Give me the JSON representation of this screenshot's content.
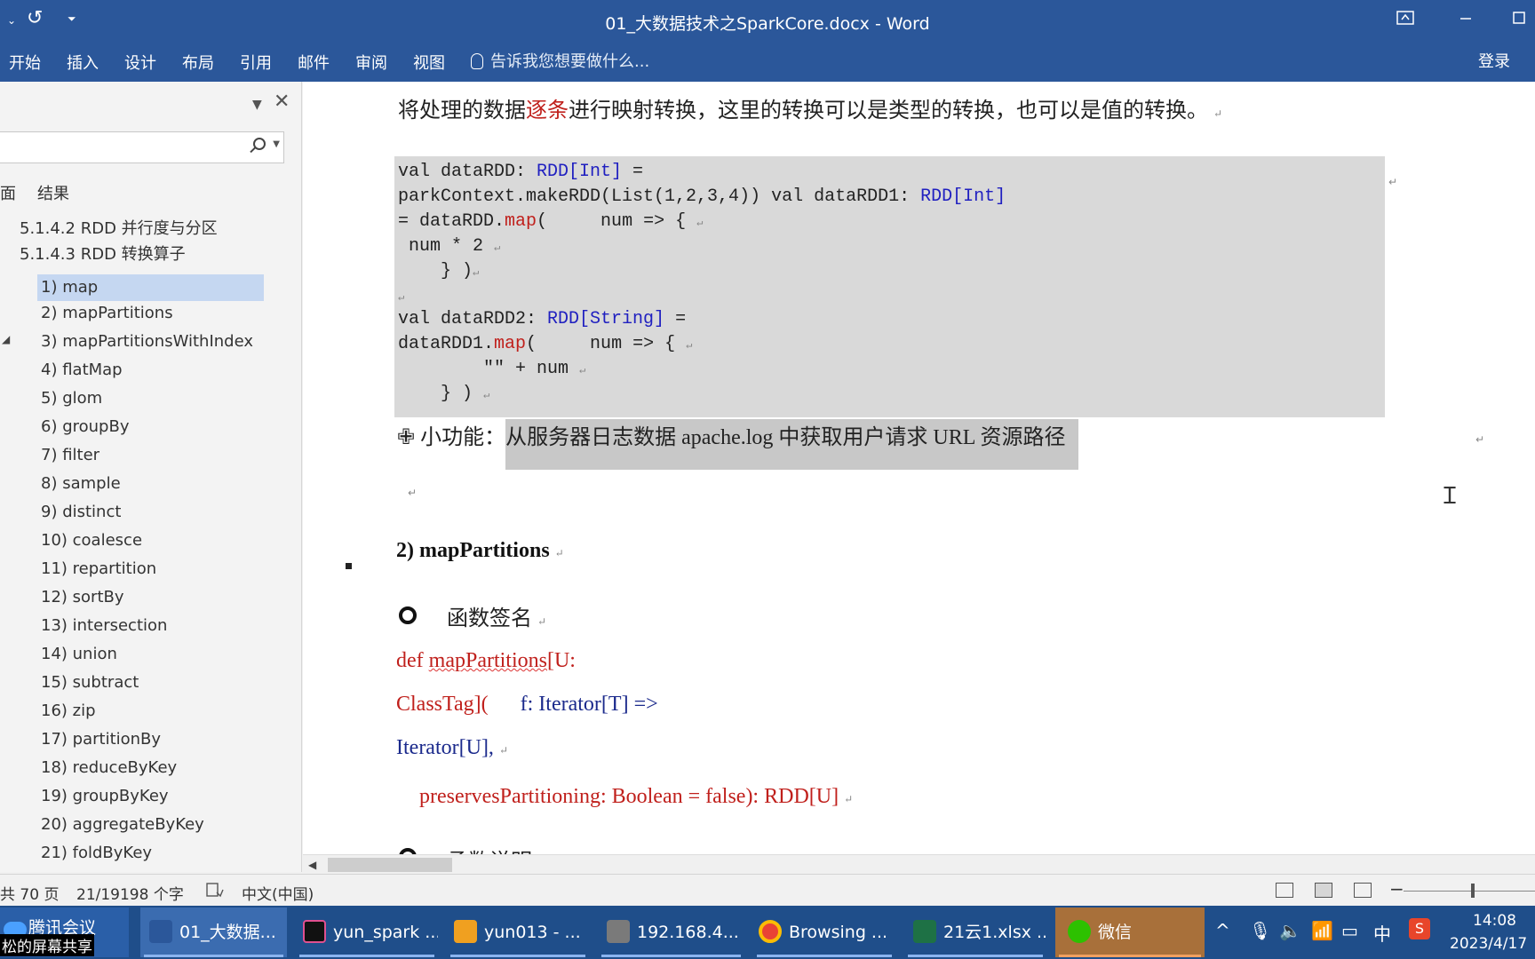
{
  "window": {
    "title": "01_大数据技术之SparkCore.docx - Word",
    "quick_access": [
      "⌄",
      "↺",
      "⏷"
    ]
  },
  "ribbon": {
    "tabs": [
      "开始",
      "插入",
      "设计",
      "布局",
      "引用",
      "邮件",
      "审阅",
      "视图"
    ],
    "tell_me": "告诉我您想要做什么...",
    "login": "登录"
  },
  "nav_pane": {
    "search_placeholder": "",
    "tab_pages": "面",
    "tab_results": "结果",
    "items": [
      "5.1.4.2 RDD 并行度与分区",
      "5.1.4.3 RDD 转换算子",
      "1) map",
      "2) mapPartitions",
      "3) mapPartitionsWithIndex",
      "4) flatMap",
      "5) glom",
      "6) groupBy",
      "7) filter",
      "8) sample",
      "9) distinct",
      "10) coalesce",
      "11) repartition",
      "12) sortBy",
      "13) intersection",
      "14) union",
      "15) subtract",
      "16) zip",
      "17) partitionBy",
      "18) reduceByKey",
      "19) groupByKey",
      "20) aggregateByKey",
      "21)  foldByKey"
    ],
    "selected_index": 2
  },
  "document": {
    "para1_before": "将处理的数据",
    "para1_red": "逐条",
    "para1_after": "进行映射转换，这里的转换可以是类型的转换，也可以是值的转换。",
    "code": {
      "l1_a": "val dataRDD: ",
      "l1_b": "RDD[Int]",
      "l1_c": " =",
      "l2_a": "parkContext.makeRDD(List(1,2,3,4)) val dataRDD1: ",
      "l2_b": "RDD[Int]",
      "l3_a": "= dataRDD.",
      "l3_b": "map",
      "l3_c": "(     num => {",
      "l4": " num * 2",
      "l5": "    } )",
      "l7_a": "val dataRDD2: ",
      "l7_b": "RDD[String]",
      "l7_c": " =",
      "l8_a": "dataRDD1.",
      "l8_b": "map",
      "l8_c": "(     num => {",
      "l9": "        \"\" + num",
      "l10": "    } )"
    },
    "feature_label": "小功能：",
    "feature_text": "从服务器日志数据  apache.log 中获取用户请求  URL 资源路径",
    "heading": "2) mapPartitions",
    "sig_heading": "函数签名",
    "def_a": "def ",
    "def_b": "mapPartitions",
    "def_c": "[U:",
    "classtag": "ClassTag](",
    "f_iter": "f: Iterator[T] =>",
    "iter_u": "Iterator[U],",
    "preserves": "preservesPartitioning: Boolean = false): RDD[U]",
    "next_heading": "函数说明"
  },
  "status_bar": {
    "pages": "共 70 页",
    "words": "21/19198 个字",
    "language": "中文(中国)"
  },
  "taskbar": {
    "meeting": "腾讯会议",
    "meeting_sub": "松的屏幕共享",
    "apps": [
      {
        "label": "01_大数据...",
        "color": "#2b579a"
      },
      {
        "label": "yun_spark ...",
        "color": "#111111"
      },
      {
        "label": "yun013 - ...",
        "color": "#f0a020"
      },
      {
        "label": "192.168.4...",
        "color": "#7a7a7a"
      },
      {
        "label": "Browsing ...",
        "color": "#e94235"
      },
      {
        "label": "21云1.xlsx ...",
        "color": "#1e7145"
      },
      {
        "label": "微信",
        "color": "#2dc100"
      }
    ],
    "ime": "中",
    "time": "14:08",
    "date": "2023/4/17"
  },
  "colors": {
    "brand": "#2b579a",
    "code_keyword_red": "#c0201c",
    "code_type_blue": "#2020c0"
  }
}
